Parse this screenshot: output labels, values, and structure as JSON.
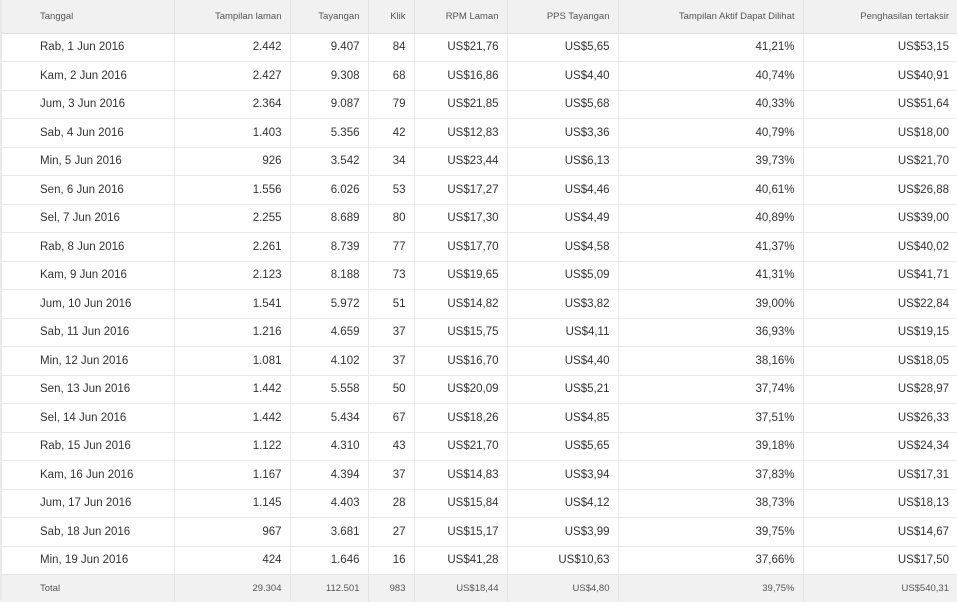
{
  "table": {
    "headers": [
      "Tanggal",
      "Tampilan laman",
      "Tayangan",
      "Klik",
      "RPM Laman",
      "PPS Tayangan",
      "Tampilan Aktif Dapat Dilihat",
      "Penghasilan tertaksir"
    ],
    "rows": [
      [
        "Rab, 1 Jun 2016",
        "2.442",
        "9.407",
        "84",
        "US$21,76",
        "US$5,65",
        "41,21%",
        "US$53,15"
      ],
      [
        "Kam, 2 Jun 2016",
        "2.427",
        "9.308",
        "68",
        "US$16,86",
        "US$4,40",
        "40,74%",
        "US$40,91"
      ],
      [
        "Jum, 3 Jun 2016",
        "2.364",
        "9.087",
        "79",
        "US$21,85",
        "US$5,68",
        "40,33%",
        "US$51,64"
      ],
      [
        "Sab, 4 Jun 2016",
        "1.403",
        "5.356",
        "42",
        "US$12,83",
        "US$3,36",
        "40,79%",
        "US$18,00"
      ],
      [
        "Min, 5 Jun 2016",
        "926",
        "3.542",
        "34",
        "US$23,44",
        "US$6,13",
        "39,73%",
        "US$21,70"
      ],
      [
        "Sen, 6 Jun 2016",
        "1.556",
        "6.026",
        "53",
        "US$17,27",
        "US$4,46",
        "40,61%",
        "US$26,88"
      ],
      [
        "Sel, 7 Jun 2016",
        "2.255",
        "8.689",
        "80",
        "US$17,30",
        "US$4,49",
        "40,89%",
        "US$39,00"
      ],
      [
        "Rab, 8 Jun 2016",
        "2.261",
        "8.739",
        "77",
        "US$17,70",
        "US$4,58",
        "41,37%",
        "US$40,02"
      ],
      [
        "Kam, 9 Jun 2016",
        "2.123",
        "8.188",
        "73",
        "US$19,65",
        "US$5,09",
        "41,31%",
        "US$41,71"
      ],
      [
        "Jum, 10 Jun 2016",
        "1.541",
        "5.972",
        "51",
        "US$14,82",
        "US$3,82",
        "39,00%",
        "US$22,84"
      ],
      [
        "Sab, 11 Jun 2016",
        "1.216",
        "4.659",
        "37",
        "US$15,75",
        "US$4,11",
        "36,93%",
        "US$19,15"
      ],
      [
        "Min, 12 Jun 2016",
        "1.081",
        "4.102",
        "37",
        "US$16,70",
        "US$4,40",
        "38,16%",
        "US$18,05"
      ],
      [
        "Sen, 13 Jun 2016",
        "1.442",
        "5.558",
        "50",
        "US$20,09",
        "US$5,21",
        "37,74%",
        "US$28,97"
      ],
      [
        "Sel, 14 Jun 2016",
        "1.442",
        "5.434",
        "67",
        "US$18,26",
        "US$4,85",
        "37,51%",
        "US$26,33"
      ],
      [
        "Rab, 15 Jun 2016",
        "1.122",
        "4.310",
        "43",
        "US$21,70",
        "US$5,65",
        "39,18%",
        "US$24,34"
      ],
      [
        "Kam, 16 Jun 2016",
        "1.167",
        "4.394",
        "37",
        "US$14,83",
        "US$3,94",
        "37,83%",
        "US$17,31"
      ],
      [
        "Jum, 17 Jun 2016",
        "1.145",
        "4.403",
        "28",
        "US$15,84",
        "US$4,12",
        "38,73%",
        "US$18,13"
      ],
      [
        "Sab, 18 Jun 2016",
        "967",
        "3.681",
        "27",
        "US$15,17",
        "US$3,99",
        "39,75%",
        "US$14,67"
      ],
      [
        "Min, 19 Jun 2016",
        "424",
        "1.646",
        "16",
        "US$41,28",
        "US$10,63",
        "37,66%",
        "US$17,50"
      ]
    ],
    "totals": [
      "Total",
      "29.304",
      "112.501",
      "983",
      "US$18,44",
      "US$4,80",
      "39,75%",
      "US$540,31"
    ]
  }
}
